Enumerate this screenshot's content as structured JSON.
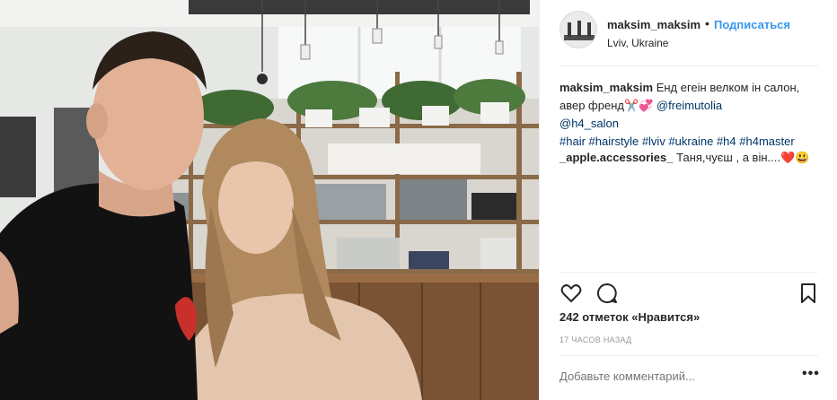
{
  "post": {
    "username": "maksim_maksim",
    "separator": "•",
    "follow_label": "Подписаться",
    "location": "Lviv, Ukraine"
  },
  "caption": {
    "username": "maksim_maksim",
    "text": "Енд егеін велком ін салон, авер френд✂️💞",
    "mention1": "@freimutolia",
    "mention2": "@h4_salon",
    "hashtags": [
      "#hair",
      "#hairstyle",
      "#lviv",
      "#ukraine",
      "#h4",
      "#h4master"
    ]
  },
  "comment": {
    "username": "_apple.accessories_",
    "text": "Таня,чуєш , а він....❤️😃"
  },
  "icons": {
    "like": "heart-outline-icon",
    "comment": "speech-bubble-icon",
    "save": "bookmark-icon"
  },
  "likes": {
    "count_text": "242 отметок «Нравится»"
  },
  "timestamp": "17 часов назад",
  "add_comment": {
    "placeholder": "Добавьте комментарий..."
  },
  "more_label": "•••",
  "colors": {
    "link": "#3897f0",
    "mention": "#003569",
    "muted": "#999999",
    "text": "#262626"
  }
}
